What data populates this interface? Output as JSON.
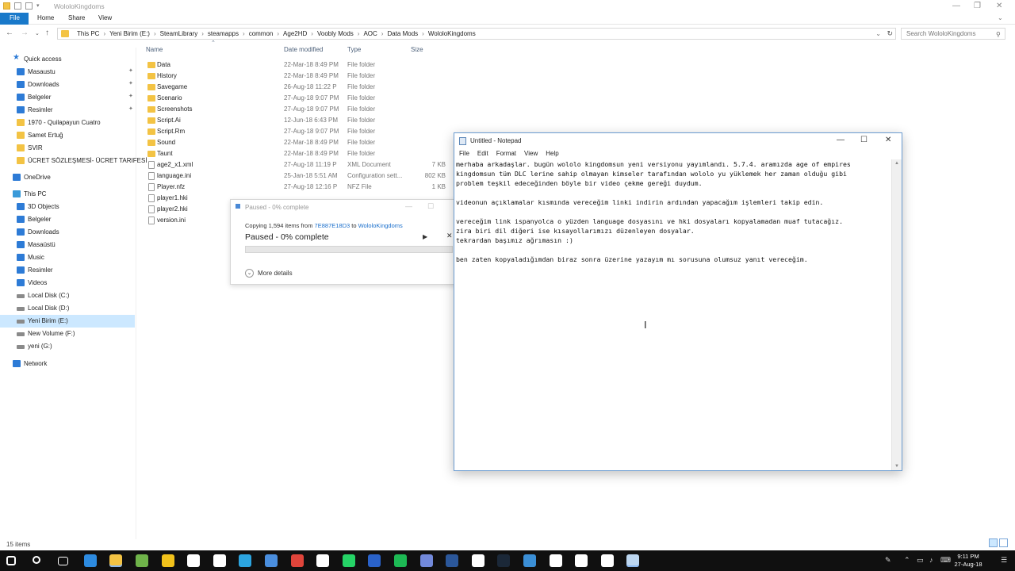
{
  "explorer": {
    "window_title": "WololoKingdoms",
    "ribbon": {
      "file": "File",
      "home": "Home",
      "share": "Share",
      "view": "View"
    },
    "breadcrumb": [
      "This PC",
      "Yeni Birim (E:)",
      "SteamLibrary",
      "steamapps",
      "common",
      "Age2HD",
      "Voobly Mods",
      "AOC",
      "Data Mods",
      "WololoKingdoms"
    ],
    "search_placeholder": "Search WololoKingdoms",
    "columns": {
      "name": "Name",
      "date": "Date modified",
      "type": "Type",
      "size": "Size"
    },
    "nav": [
      {
        "label": "Quick access",
        "kind": "star"
      },
      {
        "label": "Masaustu",
        "kind": "blue",
        "pinned": true
      },
      {
        "label": "Downloads",
        "kind": "blue",
        "pinned": true
      },
      {
        "label": "Belgeler",
        "kind": "blue",
        "pinned": true
      },
      {
        "label": "Resimler",
        "kind": "blue",
        "pinned": true
      },
      {
        "label": "1970 - Quilapayun Cuatro",
        "kind": "yellow"
      },
      {
        "label": "Samet Ertuğ",
        "kind": "yellow"
      },
      {
        "label": "SVIR",
        "kind": "yellow"
      },
      {
        "label": "ÜCRET SÖZLEŞMESİ- ÜCRET TARIFESİ",
        "kind": "yellow"
      },
      {
        "label": "OneDrive",
        "kind": "blue"
      },
      {
        "label": "This PC",
        "kind": "pc"
      },
      {
        "label": "3D Objects",
        "kind": "blue"
      },
      {
        "label": "Belgeler",
        "kind": "blue"
      },
      {
        "label": "Downloads",
        "kind": "blue"
      },
      {
        "label": "Masaüstü",
        "kind": "blue"
      },
      {
        "label": "Music",
        "kind": "blue"
      },
      {
        "label": "Resimler",
        "kind": "blue"
      },
      {
        "label": "Videos",
        "kind": "blue"
      },
      {
        "label": "Local Disk (C:)",
        "kind": "drive"
      },
      {
        "label": "Local Disk (D:)",
        "kind": "drive"
      },
      {
        "label": "Yeni Birim (E:)",
        "kind": "drive",
        "selected": true
      },
      {
        "label": "New Volume (F:)",
        "kind": "drive"
      },
      {
        "label": "yeni (G:)",
        "kind": "drive"
      },
      {
        "label": "Network",
        "kind": "blue"
      }
    ],
    "files": [
      {
        "name": "Data",
        "date": "22-Mar-18 8:49 PM",
        "type": "File folder",
        "size": "",
        "folder": true
      },
      {
        "name": "History",
        "date": "22-Mar-18 8:49 PM",
        "type": "File folder",
        "size": "",
        "folder": true
      },
      {
        "name": "Savegame",
        "date": "26-Aug-18 11:22 P",
        "type": "File folder",
        "size": "",
        "folder": true
      },
      {
        "name": "Scenario",
        "date": "27-Aug-18 9:07 PM",
        "type": "File folder",
        "size": "",
        "folder": true
      },
      {
        "name": "Screenshots",
        "date": "27-Aug-18 9:07 PM",
        "type": "File folder",
        "size": "",
        "folder": true
      },
      {
        "name": "Script.Ai",
        "date": "12-Jun-18 6:43 PM",
        "type": "File folder",
        "size": "",
        "folder": true
      },
      {
        "name": "Script.Rm",
        "date": "27-Aug-18 9:07 PM",
        "type": "File folder",
        "size": "",
        "folder": true
      },
      {
        "name": "Sound",
        "date": "22-Mar-18 8:49 PM",
        "type": "File folder",
        "size": "",
        "folder": true
      },
      {
        "name": "Taunt",
        "date": "22-Mar-18 8:49 PM",
        "type": "File folder",
        "size": "",
        "folder": true
      },
      {
        "name": "age2_x1.xml",
        "date": "27-Aug-18 11:19 P",
        "type": "XML Document",
        "size": "7 KB",
        "folder": false
      },
      {
        "name": "language.ini",
        "date": "25-Jan-18 5:51 AM",
        "type": "Configuration sett...",
        "size": "802 KB",
        "folder": false
      },
      {
        "name": "Player.nfz",
        "date": "27-Aug-18 12:16 P",
        "type": "NFZ File",
        "size": "1 KB",
        "folder": false
      },
      {
        "name": "player1.hki",
        "date": "",
        "type": "",
        "size": "",
        "folder": false
      },
      {
        "name": "player2.hki",
        "date": "",
        "type": "",
        "size": "",
        "folder": false
      },
      {
        "name": "version.ini",
        "date": "",
        "type": "",
        "size": "",
        "folder": false
      }
    ],
    "status": "15 items"
  },
  "copy_dialog": {
    "title": "Paused - 0% complete",
    "info_prefix": "Copying 1,594 items from ",
    "from": "7E887E18D3",
    "to_word": " to ",
    "to": "WololoKingdoms",
    "status": "Paused - 0% complete",
    "progress_percent": 0,
    "more_details": "More details"
  },
  "notepad": {
    "title": "Untitled - Notepad",
    "menu": [
      "File",
      "Edit",
      "Format",
      "View",
      "Help"
    ],
    "lines": [
      "merhaba arkadaşlar. bugün wololo kingdomsun yeni versiyonu yayımlandı. 5.7.4. aramızda age of empires",
      "kingdomsun tüm DLC lerine sahip olmayan kimseler tarafından wololo yu yüklemek her zaman olduğu gibi",
      "problem teşkil edeceğinden böyle bir video çekme gereği duydum.",
      "",
      "videonun açıklamalar kısmında vereceğim linki indirin ardından yapacağım işlemleri takip edin.",
      "",
      "vereceğim link ispanyolca o yüzden language dosyasını ve hki dosyaları kopyalamadan muaf tutacağız.",
      "zira biri dil diğeri ise kısayollarımızı düzenleyen dosyalar.",
      "tekrardan başımız ağrımasın :)",
      "",
      "ben zaten kopyaladığımdan biraz sonra üzerine yazayım mı sorusuna olumsuz yanıt vereceğim."
    ]
  },
  "taskbar": {
    "time": "9:11 PM",
    "date": "27-Aug-18",
    "icons": [
      "start-icon",
      "search-icon",
      "task-view-icon",
      "edge-icon",
      "file-explorer-icon",
      "store-icon",
      "radiation-app-icon",
      "mail-icon",
      "notes-icon",
      "telegram-icon",
      "drop-app-icon",
      "vivaldi-icon",
      "books-icon",
      "whatsapp-icon",
      "voobly-icon",
      "spotify-icon",
      "discord-icon",
      "word-icon",
      "calculator-icon",
      "steam-icon",
      "screen-icon",
      "steam-tray-icon",
      "calendar-icon",
      "settings-icon",
      "notepad-icon"
    ]
  }
}
